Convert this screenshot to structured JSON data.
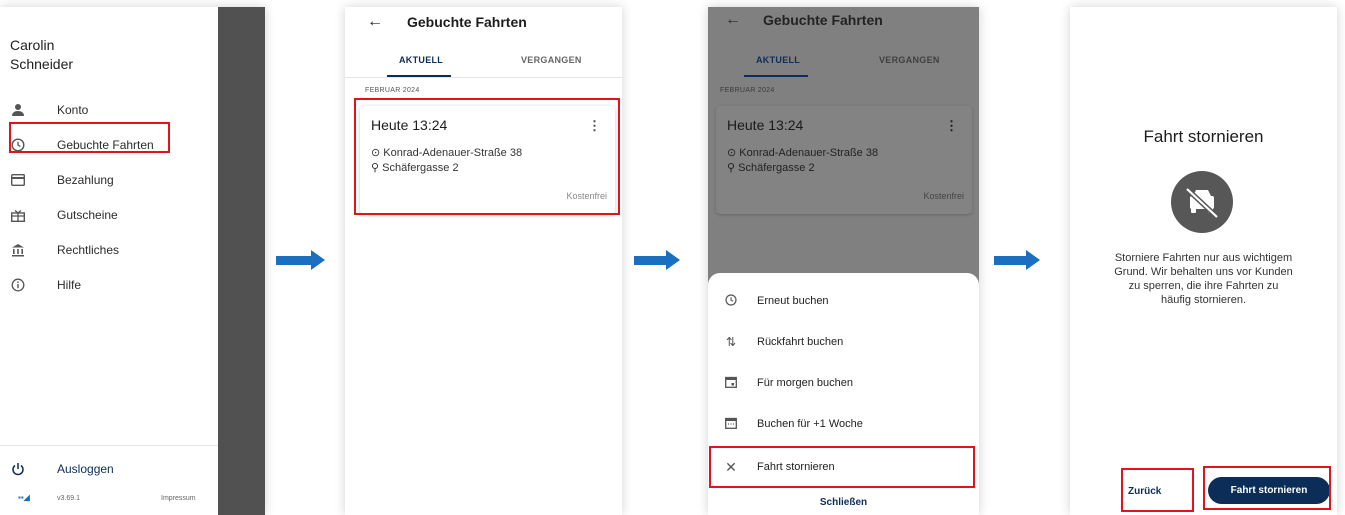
{
  "drawer": {
    "first_name": "Carolin",
    "last_name": "Schneider",
    "items": [
      {
        "label": "Konto",
        "icon": "person-icon"
      },
      {
        "label": "Gebuchte Fahrten",
        "icon": "clock-icon"
      },
      {
        "label": "Bezahlung",
        "icon": "credit-card-icon"
      },
      {
        "label": "Gutscheine",
        "icon": "gift-icon"
      },
      {
        "label": "Rechtliches",
        "icon": "bank-icon"
      },
      {
        "label": "Hilfe",
        "icon": "info-icon"
      }
    ],
    "logout_label": "Ausloggen",
    "version": "v3.69.1",
    "impressum": "Impressum"
  },
  "bookings": {
    "title": "Gebuchte Fahrten",
    "tabs": [
      "AKTUELL",
      "VERGANGEN"
    ],
    "active_tab": "AKTUELL",
    "month": "FEBRUAR 2024",
    "ride": {
      "time": "Heute 13:24",
      "from": "Konrad-Adenauer-Straße 38",
      "to": "Schäfergasse 2",
      "price": "Kostenfrei"
    }
  },
  "actions_sheet": {
    "items": [
      {
        "label": "Erneut buchen",
        "icon": "clock-icon"
      },
      {
        "label": "Rückfahrt buchen",
        "icon": "swap-icon"
      },
      {
        "label": "Für morgen buchen",
        "icon": "calendar-day-icon"
      },
      {
        "label": "Buchen für +1 Woche",
        "icon": "calendar-week-icon"
      },
      {
        "label": "Fahrt stornieren",
        "icon": "close-icon"
      }
    ],
    "close_label": "Schließen"
  },
  "cancel_dialog": {
    "title": "Fahrt stornieren",
    "body": "Storniere Fahrten nur aus wichtigem Grund. Wir behalten uns vor Kunden zu sperren, die ihre Fahrten zu häufig stornieren.",
    "back_label": "Zurück",
    "confirm_label": "Fahrt stornieren"
  },
  "colors": {
    "accent": "#0c2d57",
    "highlight": "#e1141c",
    "arrow": "#1b6fc0"
  }
}
